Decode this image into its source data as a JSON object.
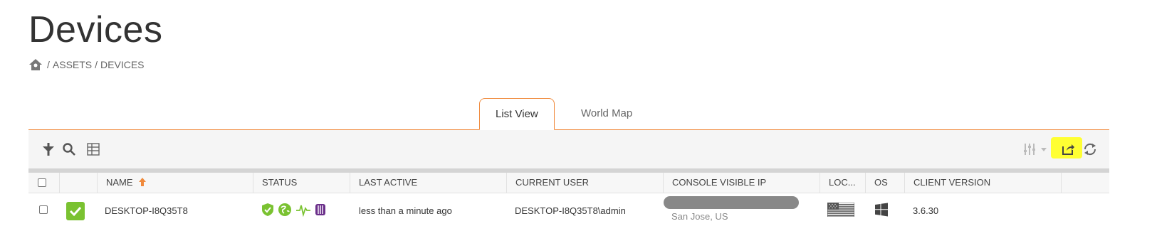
{
  "page": {
    "title": "Devices"
  },
  "breadcrumb": {
    "items": [
      "ASSETS",
      "DEVICES"
    ],
    "separator": "/"
  },
  "tabs": [
    {
      "label": "List View",
      "active": true
    },
    {
      "label": "World Map",
      "active": false
    }
  ],
  "toolbar": {
    "left_icons": [
      "filter-tree-icon",
      "search-icon",
      "columns-icon"
    ],
    "right_icons": [
      "adjust-sliders-icon",
      "export-icon",
      "refresh-icon"
    ]
  },
  "table": {
    "columns": [
      "NAME",
      "STATUS",
      "LAST ACTIVE",
      "CURRENT USER",
      "CONSOLE VISIBLE IP",
      "LOC...",
      "OS",
      "CLIENT VERSION"
    ],
    "sort": {
      "column": "NAME",
      "direction": "ascending"
    },
    "rows": [
      {
        "name": "DESKTOP-I8Q35T8",
        "status_icons": [
          "shield-check-icon",
          "globe-icon",
          "activity-icon",
          "purple-app-icon"
        ],
        "last_active": "less than a minute ago",
        "current_user": "DESKTOP-I8Q35T8\\admin",
        "ip_location": "San Jose, US",
        "location_flag": "us-flag-icon",
        "os": "windows-icon",
        "client_version": "3.6.30"
      }
    ]
  },
  "colors": {
    "accent": "#f08a3c",
    "highlight": "#ffff33",
    "status_green": "#7ac231",
    "purple": "#6b2f8a"
  }
}
